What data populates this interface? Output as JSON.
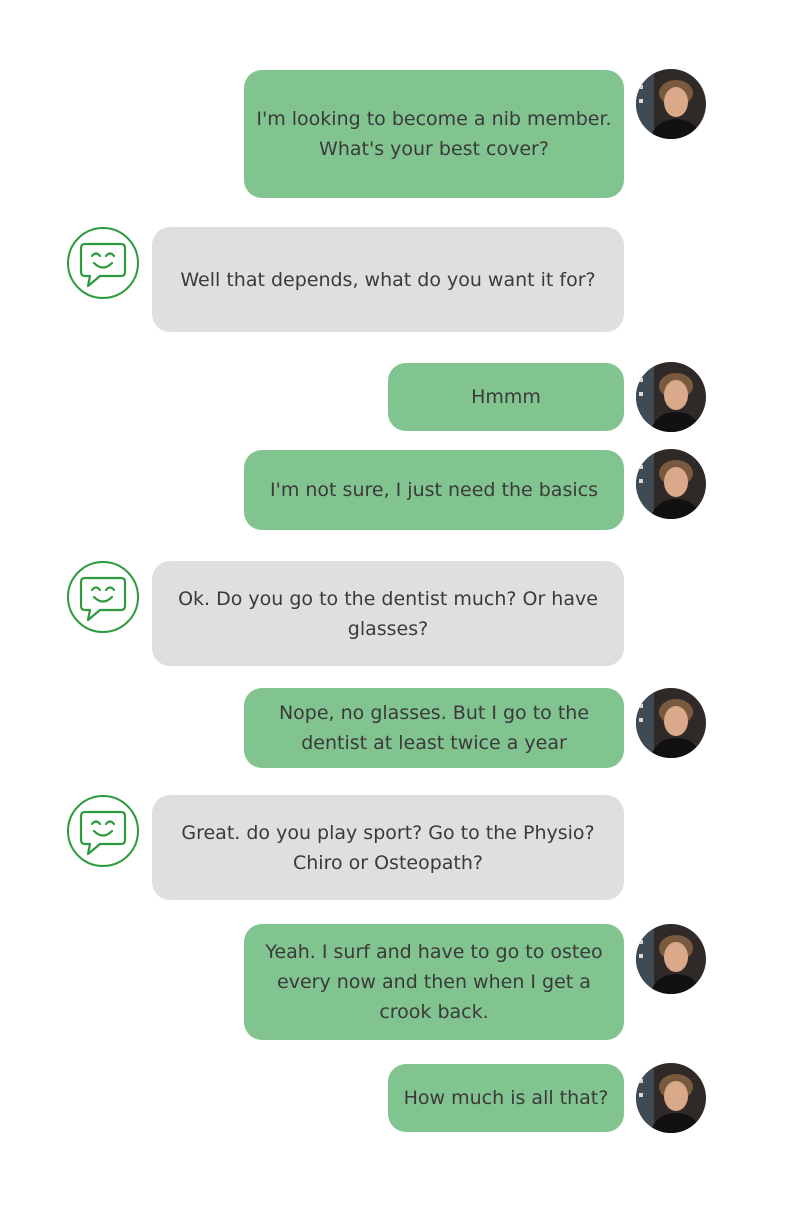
{
  "messages": [
    {
      "sender": "user",
      "text": "I'm looking to become a nib member. What's your best cover?",
      "avatar_icon": "user-avatar-photo"
    },
    {
      "sender": "bot",
      "text": "Well that depends, what do you want it for?",
      "avatar_icon": "smiley-chat-bubble-icon"
    },
    {
      "sender": "user",
      "text": "Hmmm",
      "avatar_icon": "user-avatar-photo"
    },
    {
      "sender": "user",
      "text": "I'm not sure, I just need the basics",
      "avatar_icon": "user-avatar-photo"
    },
    {
      "sender": "bot",
      "text": "Ok. Do you go to the dentist much? Or have glasses?",
      "avatar_icon": "smiley-chat-bubble-icon"
    },
    {
      "sender": "user",
      "text": "Nope, no glasses. But I go to the dentist at least twice a year",
      "avatar_icon": "user-avatar-photo"
    },
    {
      "sender": "bot",
      "text": "Great. do you play sport? Go to the Physio? Chiro or Osteopath?",
      "avatar_icon": "smiley-chat-bubble-icon"
    },
    {
      "sender": "user",
      "text": "Yeah. I surf and have to go to osteo every now and then when I get a crook back.",
      "avatar_icon": "user-avatar-photo"
    },
    {
      "sender": "user",
      "text": "How much is all that?",
      "avatar_icon": "user-avatar-photo"
    }
  ],
  "colors": {
    "user_bubble": "#81c48f",
    "bot_bubble": "#e1dfde",
    "bot_icon_stroke": "#2e9a3e",
    "text": "#3a3a3a"
  }
}
